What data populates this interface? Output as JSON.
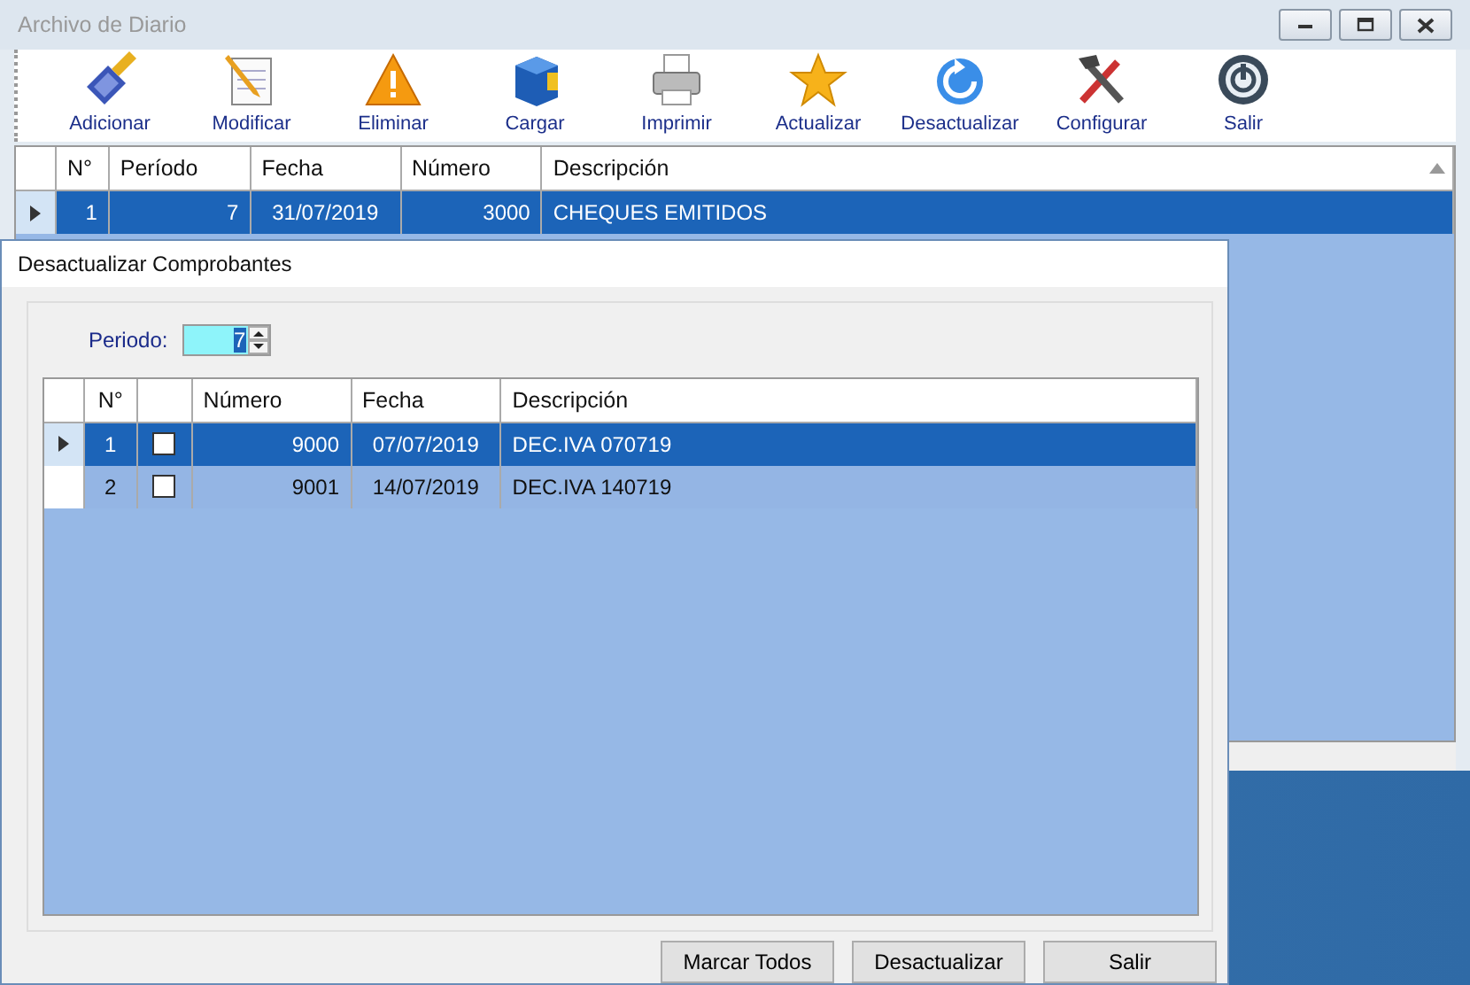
{
  "window": {
    "title": "Archivo de Diario"
  },
  "toolbar": [
    {
      "label": "Adicionar"
    },
    {
      "label": "Modificar"
    },
    {
      "label": "Eliminar"
    },
    {
      "label": "Cargar"
    },
    {
      "label": "Imprimir"
    },
    {
      "label": "Actualizar"
    },
    {
      "label": "Desactualizar"
    },
    {
      "label": "Configurar"
    },
    {
      "label": "Salir"
    }
  ],
  "main_grid": {
    "columns": [
      "N°",
      "Período",
      "Fecha",
      "Número",
      "Descripción"
    ],
    "rows": [
      {
        "cells": [
          "1",
          "7",
          "31/07/2019",
          "3000",
          "CHEQUES EMITIDOS"
        ],
        "selected": true
      }
    ]
  },
  "dialog": {
    "title": "Desactualizar Comprobantes",
    "period_label": "Periodo:",
    "period_value": "7",
    "grid": {
      "columns": [
        {
          "kind": "text",
          "label": "N°"
        },
        {
          "kind": "check"
        },
        {
          "kind": "text",
          "label": "Número"
        },
        {
          "kind": "text",
          "label": "Fecha"
        },
        {
          "kind": "text",
          "label": "Descripción"
        }
      ],
      "rows": [
        {
          "n": "1",
          "checked": false,
          "numero": "9000",
          "fecha": "07/07/2019",
          "descripcion": "DEC.IVA 070719",
          "selected": true
        },
        {
          "n": "2",
          "checked": false,
          "numero": "9001",
          "fecha": "14/07/2019",
          "descripcion": "DEC.IVA 140719",
          "selected": false
        }
      ]
    },
    "buttons": [
      "Marcar Todos",
      "Desactualizar",
      "Salir"
    ]
  }
}
